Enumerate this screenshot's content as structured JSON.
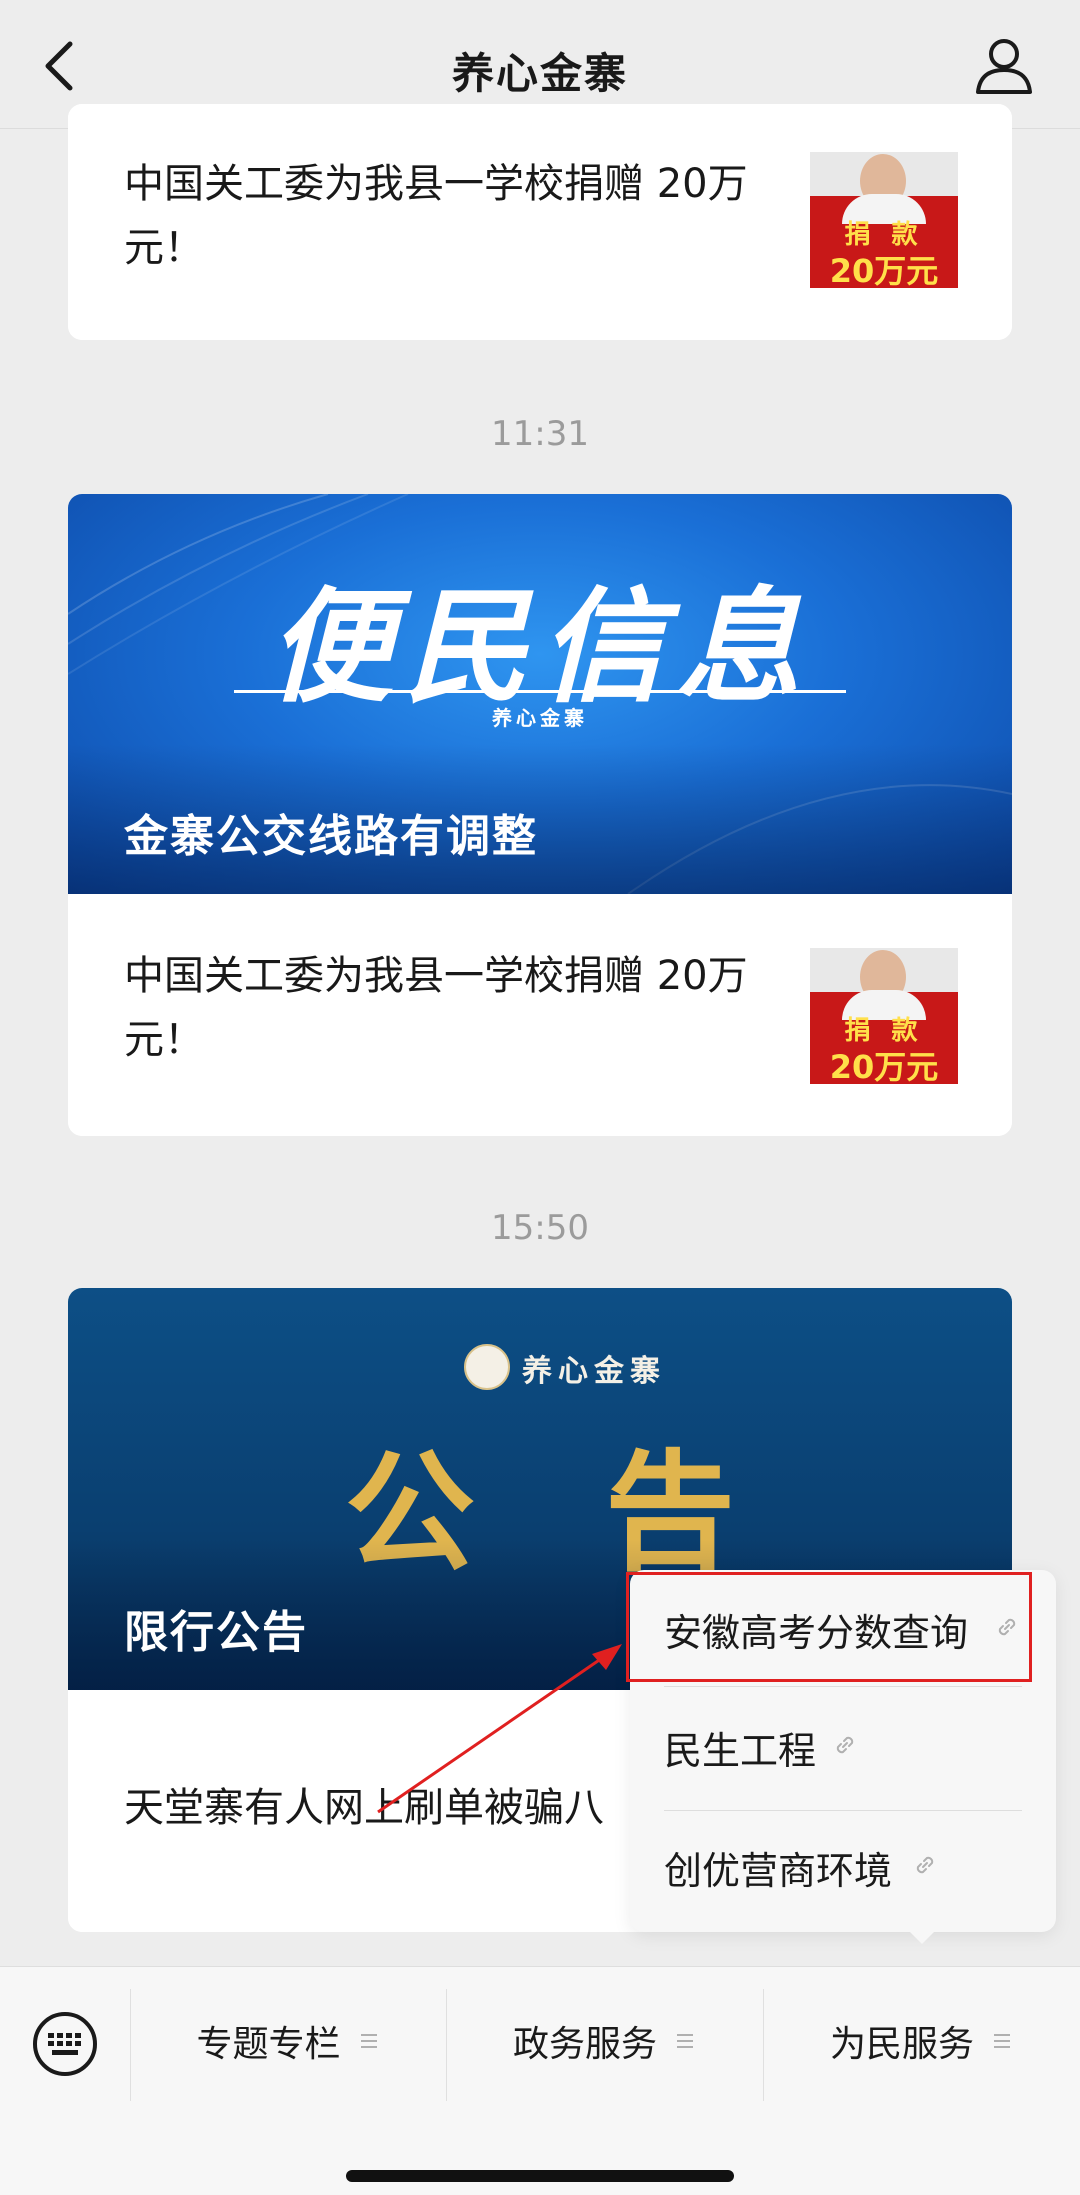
{
  "header": {
    "title": "养心金寨"
  },
  "messages": {
    "top_item": {
      "text": "中国关工委为我县一学校捐赠 20万元！",
      "thumb_line1": "捐 款",
      "thumb_line2": "20万元"
    },
    "time1": "11:31",
    "group1": {
      "banner_title": "便民信息",
      "banner_sub": "养心金寨",
      "banner_caption": "金寨公交线路有调整",
      "item": {
        "text": "中国关工委为我县一学校捐赠 20万元！",
        "thumb_line1": "捐 款",
        "thumb_line2": "20万元"
      }
    },
    "time2": "15:50",
    "group2": {
      "logo_text": "养心金寨",
      "banner_title": "公告",
      "banner_caption": "限行公告",
      "item": {
        "text": "天堂寨有人网上刷单被骗八"
      }
    }
  },
  "popup_menu": {
    "items": [
      {
        "label": "安徽高考分数查询",
        "icon": "link-icon",
        "highlighted": true
      },
      {
        "label": "民生工程",
        "icon": "link-icon"
      },
      {
        "label": "创优营商环境",
        "icon": "link-icon"
      }
    ]
  },
  "bottom_menu": {
    "keyboard_icon": "keyboard-icon",
    "items": [
      {
        "label": "专题专栏"
      },
      {
        "label": "政务服务"
      },
      {
        "label": "为民服务"
      }
    ]
  },
  "colors": {
    "highlight_border": "#e02020",
    "banner_blue": "#1a6fd6",
    "banner_dark": "#0a3f70",
    "notice_gold": "#e0b54e"
  }
}
